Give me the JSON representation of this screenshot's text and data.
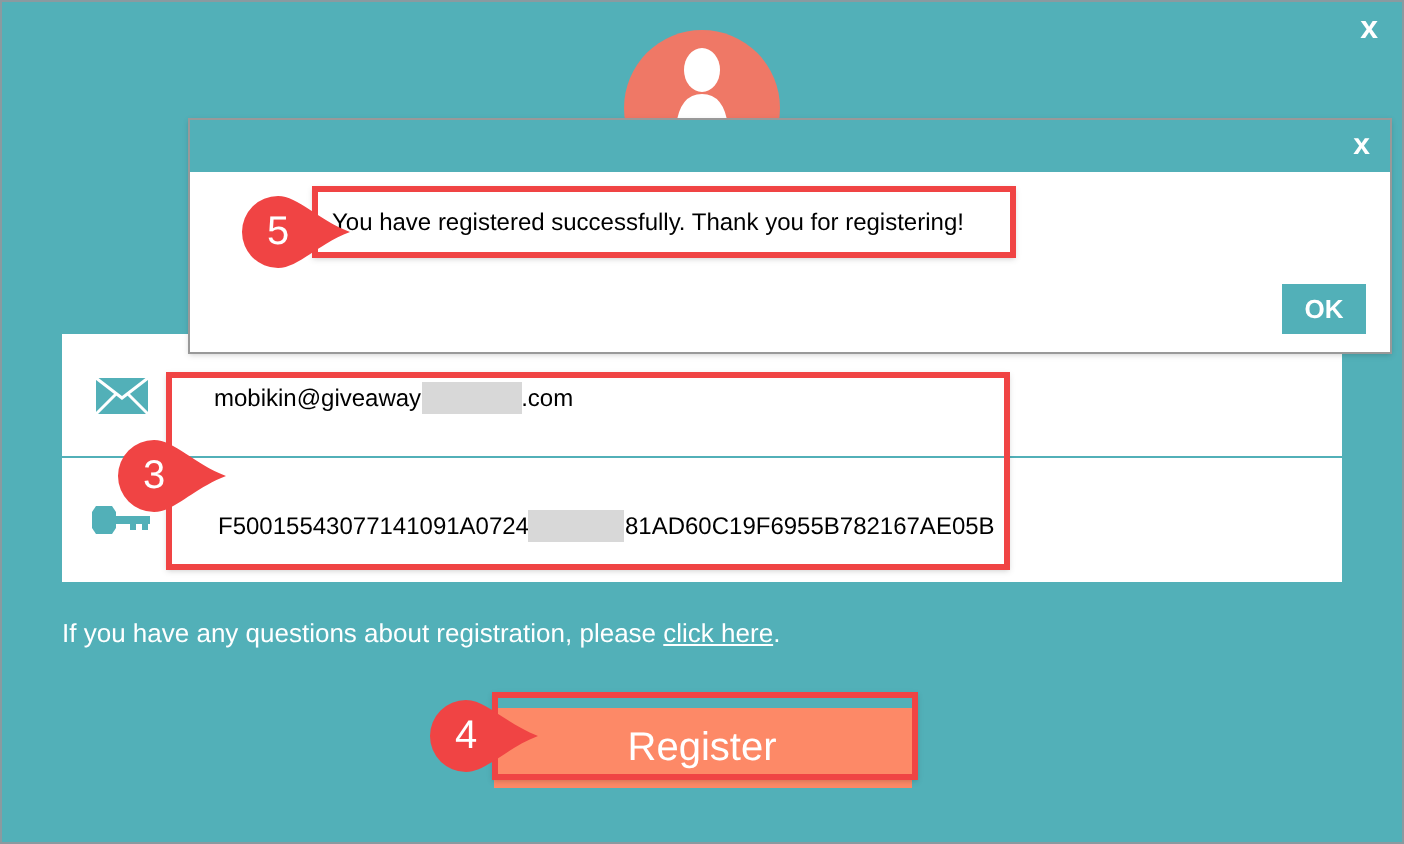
{
  "window": {
    "close": "x"
  },
  "message_box": {
    "close": "x",
    "text": "You have registered successfully. Thank you for registering!",
    "ok": "OK"
  },
  "form": {
    "email": {
      "start": "mobikin@giveaway",
      "end": ".com"
    },
    "license_key": {
      "start": "F50015543077141091A0724",
      "end": "81AD60C19F6955B782167AE05B"
    }
  },
  "help": {
    "text": "If you have any questions about registration, please ",
    "link": "click here",
    "after": "."
  },
  "register_button": "Register",
  "annotations": [
    {
      "label": "3",
      "kind": "fields"
    },
    {
      "label": "4",
      "kind": "register"
    },
    {
      "label": "5",
      "kind": "message"
    }
  ]
}
